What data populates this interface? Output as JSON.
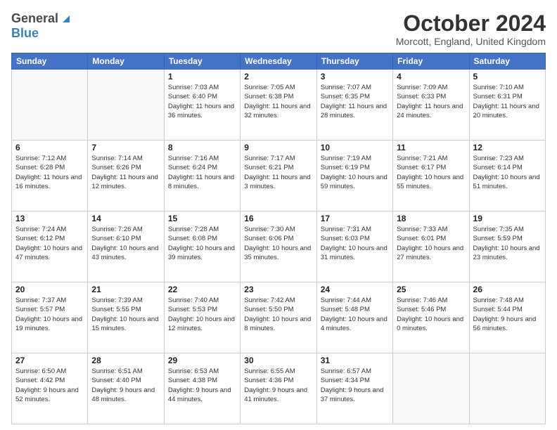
{
  "header": {
    "logo_general": "General",
    "logo_blue": "Blue",
    "month_title": "October 2024",
    "location": "Morcott, England, United Kingdom"
  },
  "days_of_week": [
    "Sunday",
    "Monday",
    "Tuesday",
    "Wednesday",
    "Thursday",
    "Friday",
    "Saturday"
  ],
  "weeks": [
    [
      {
        "day": "",
        "sunrise": "",
        "sunset": "",
        "daylight": "",
        "empty": true
      },
      {
        "day": "",
        "sunrise": "",
        "sunset": "",
        "daylight": "",
        "empty": true
      },
      {
        "day": "1",
        "sunrise": "Sunrise: 7:03 AM",
        "sunset": "Sunset: 6:40 PM",
        "daylight": "Daylight: 11 hours and 36 minutes."
      },
      {
        "day": "2",
        "sunrise": "Sunrise: 7:05 AM",
        "sunset": "Sunset: 6:38 PM",
        "daylight": "Daylight: 11 hours and 32 minutes."
      },
      {
        "day": "3",
        "sunrise": "Sunrise: 7:07 AM",
        "sunset": "Sunset: 6:35 PM",
        "daylight": "Daylight: 11 hours and 28 minutes."
      },
      {
        "day": "4",
        "sunrise": "Sunrise: 7:09 AM",
        "sunset": "Sunset: 6:33 PM",
        "daylight": "Daylight: 11 hours and 24 minutes."
      },
      {
        "day": "5",
        "sunrise": "Sunrise: 7:10 AM",
        "sunset": "Sunset: 6:31 PM",
        "daylight": "Daylight: 11 hours and 20 minutes."
      }
    ],
    [
      {
        "day": "6",
        "sunrise": "Sunrise: 7:12 AM",
        "sunset": "Sunset: 6:28 PM",
        "daylight": "Daylight: 11 hours and 16 minutes."
      },
      {
        "day": "7",
        "sunrise": "Sunrise: 7:14 AM",
        "sunset": "Sunset: 6:26 PM",
        "daylight": "Daylight: 11 hours and 12 minutes."
      },
      {
        "day": "8",
        "sunrise": "Sunrise: 7:16 AM",
        "sunset": "Sunset: 6:24 PM",
        "daylight": "Daylight: 11 hours and 8 minutes."
      },
      {
        "day": "9",
        "sunrise": "Sunrise: 7:17 AM",
        "sunset": "Sunset: 6:21 PM",
        "daylight": "Daylight: 11 hours and 3 minutes."
      },
      {
        "day": "10",
        "sunrise": "Sunrise: 7:19 AM",
        "sunset": "Sunset: 6:19 PM",
        "daylight": "Daylight: 10 hours and 59 minutes."
      },
      {
        "day": "11",
        "sunrise": "Sunrise: 7:21 AM",
        "sunset": "Sunset: 6:17 PM",
        "daylight": "Daylight: 10 hours and 55 minutes."
      },
      {
        "day": "12",
        "sunrise": "Sunrise: 7:23 AM",
        "sunset": "Sunset: 6:14 PM",
        "daylight": "Daylight: 10 hours and 51 minutes."
      }
    ],
    [
      {
        "day": "13",
        "sunrise": "Sunrise: 7:24 AM",
        "sunset": "Sunset: 6:12 PM",
        "daylight": "Daylight: 10 hours and 47 minutes."
      },
      {
        "day": "14",
        "sunrise": "Sunrise: 7:26 AM",
        "sunset": "Sunset: 6:10 PM",
        "daylight": "Daylight: 10 hours and 43 minutes."
      },
      {
        "day": "15",
        "sunrise": "Sunrise: 7:28 AM",
        "sunset": "Sunset: 6:08 PM",
        "daylight": "Daylight: 10 hours and 39 minutes."
      },
      {
        "day": "16",
        "sunrise": "Sunrise: 7:30 AM",
        "sunset": "Sunset: 6:06 PM",
        "daylight": "Daylight: 10 hours and 35 minutes."
      },
      {
        "day": "17",
        "sunrise": "Sunrise: 7:31 AM",
        "sunset": "Sunset: 6:03 PM",
        "daylight": "Daylight: 10 hours and 31 minutes."
      },
      {
        "day": "18",
        "sunrise": "Sunrise: 7:33 AM",
        "sunset": "Sunset: 6:01 PM",
        "daylight": "Daylight: 10 hours and 27 minutes."
      },
      {
        "day": "19",
        "sunrise": "Sunrise: 7:35 AM",
        "sunset": "Sunset: 5:59 PM",
        "daylight": "Daylight: 10 hours and 23 minutes."
      }
    ],
    [
      {
        "day": "20",
        "sunrise": "Sunrise: 7:37 AM",
        "sunset": "Sunset: 5:57 PM",
        "daylight": "Daylight: 10 hours and 19 minutes."
      },
      {
        "day": "21",
        "sunrise": "Sunrise: 7:39 AM",
        "sunset": "Sunset: 5:55 PM",
        "daylight": "Daylight: 10 hours and 15 minutes."
      },
      {
        "day": "22",
        "sunrise": "Sunrise: 7:40 AM",
        "sunset": "Sunset: 5:53 PM",
        "daylight": "Daylight: 10 hours and 12 minutes."
      },
      {
        "day": "23",
        "sunrise": "Sunrise: 7:42 AM",
        "sunset": "Sunset: 5:50 PM",
        "daylight": "Daylight: 10 hours and 8 minutes."
      },
      {
        "day": "24",
        "sunrise": "Sunrise: 7:44 AM",
        "sunset": "Sunset: 5:48 PM",
        "daylight": "Daylight: 10 hours and 4 minutes."
      },
      {
        "day": "25",
        "sunrise": "Sunrise: 7:46 AM",
        "sunset": "Sunset: 5:46 PM",
        "daylight": "Daylight: 10 hours and 0 minutes."
      },
      {
        "day": "26",
        "sunrise": "Sunrise: 7:48 AM",
        "sunset": "Sunset: 5:44 PM",
        "daylight": "Daylight: 9 hours and 56 minutes."
      }
    ],
    [
      {
        "day": "27",
        "sunrise": "Sunrise: 6:50 AM",
        "sunset": "Sunset: 4:42 PM",
        "daylight": "Daylight: 9 hours and 52 minutes."
      },
      {
        "day": "28",
        "sunrise": "Sunrise: 6:51 AM",
        "sunset": "Sunset: 4:40 PM",
        "daylight": "Daylight: 9 hours and 48 minutes."
      },
      {
        "day": "29",
        "sunrise": "Sunrise: 6:53 AM",
        "sunset": "Sunset: 4:38 PM",
        "daylight": "Daylight: 9 hours and 44 minutes."
      },
      {
        "day": "30",
        "sunrise": "Sunrise: 6:55 AM",
        "sunset": "Sunset: 4:36 PM",
        "daylight": "Daylight: 9 hours and 41 minutes."
      },
      {
        "day": "31",
        "sunrise": "Sunrise: 6:57 AM",
        "sunset": "Sunset: 4:34 PM",
        "daylight": "Daylight: 9 hours and 37 minutes."
      },
      {
        "day": "",
        "sunrise": "",
        "sunset": "",
        "daylight": "",
        "empty": true
      },
      {
        "day": "",
        "sunrise": "",
        "sunset": "",
        "daylight": "",
        "empty": true
      }
    ]
  ]
}
